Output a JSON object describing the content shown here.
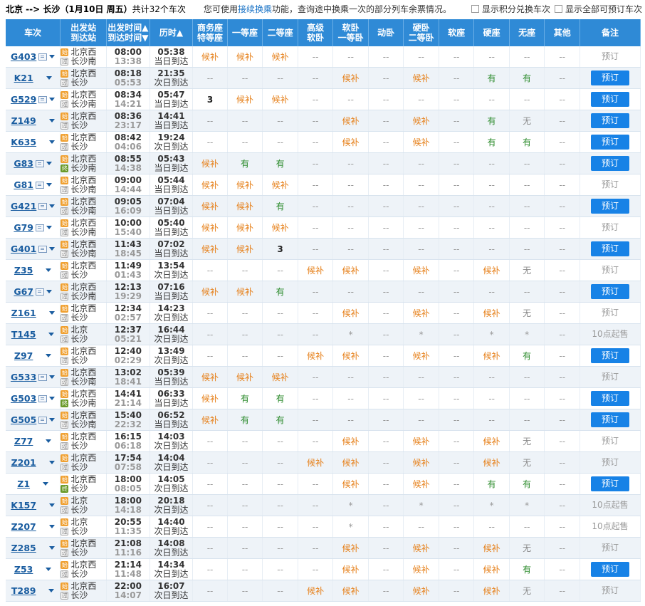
{
  "top": {
    "route": "北京 --> 长沙",
    "date": "（1月10日  周五）",
    "count_text": "共计32个车次",
    "hint_pre": "您可使用",
    "hint_link": "接续换乘",
    "hint_post": "功能，查询途中换乘一次的部分列车余票情况。",
    "opt1": "显示积分兑换车次",
    "opt2": "显示全部可预订车次"
  },
  "header": {
    "train": "车次",
    "station": [
      "出发站",
      "到达站"
    ],
    "time": [
      "出发时间▲",
      "到达时间▼"
    ],
    "duration": "历时▲",
    "seats": [
      [
        "商务座",
        "特等座"
      ],
      [
        "一等座"
      ],
      [
        "二等座"
      ],
      [
        "高级",
        "软卧"
      ],
      [
        "软卧",
        "一等卧"
      ],
      [
        "动卧"
      ],
      [
        "硬卧",
        "二等卧"
      ],
      [
        "软座"
      ],
      [
        "硬座"
      ],
      [
        "无座"
      ],
      [
        "其他"
      ]
    ],
    "remark": "备注"
  },
  "rows": [
    {
      "no": "G403",
      "icon": true,
      "from": "北京西",
      "to": "长沙南",
      "fb": "s",
      "tb": "p",
      "dep": "08:00",
      "arr": "13:38",
      "dur": "05:38",
      "note": "当日到达",
      "seats": [
        "候补",
        "候补",
        "候补",
        "--",
        "--",
        "--",
        "--",
        "--",
        "--",
        "--",
        "--"
      ],
      "btn": "预订",
      "on": false
    },
    {
      "no": "K21",
      "icon": false,
      "from": "北京西",
      "to": "长沙",
      "fb": "s",
      "tb": "p",
      "dep": "08:18",
      "arr": "05:53",
      "dur": "21:35",
      "note": "次日到达",
      "seats": [
        "--",
        "--",
        "--",
        "--",
        "候补",
        "--",
        "候补",
        "--",
        "有",
        "有",
        "--"
      ],
      "btn": "预订",
      "on": true
    },
    {
      "no": "G529",
      "icon": true,
      "from": "北京西",
      "to": "长沙南",
      "fb": "s",
      "tb": "p",
      "dep": "08:34",
      "arr": "14:21",
      "dur": "05:47",
      "note": "当日到达",
      "seats": [
        "3",
        "候补",
        "候补",
        "--",
        "--",
        "--",
        "--",
        "--",
        "--",
        "--",
        "--"
      ],
      "btn": "预订",
      "on": true
    },
    {
      "no": "Z149",
      "icon": false,
      "from": "北京西",
      "to": "长沙",
      "fb": "s",
      "tb": "p",
      "dep": "08:36",
      "arr": "23:17",
      "dur": "14:41",
      "note": "当日到达",
      "seats": [
        "--",
        "--",
        "--",
        "--",
        "候补",
        "--",
        "候补",
        "--",
        "有",
        "无",
        "--"
      ],
      "btn": "预订",
      "on": true
    },
    {
      "no": "K635",
      "icon": false,
      "from": "北京西",
      "to": "长沙",
      "fb": "s",
      "tb": "p",
      "dep": "08:42",
      "arr": "04:06",
      "dur": "19:24",
      "note": "次日到达",
      "seats": [
        "--",
        "--",
        "--",
        "--",
        "候补",
        "--",
        "候补",
        "--",
        "有",
        "有",
        "--"
      ],
      "btn": "预订",
      "on": true
    },
    {
      "no": "G83",
      "icon": true,
      "from": "北京西",
      "to": "长沙南",
      "fb": "s",
      "tb": "e",
      "dep": "08:55",
      "arr": "14:38",
      "dur": "05:43",
      "note": "当日到达",
      "seats": [
        "候补",
        "有",
        "有",
        "--",
        "--",
        "--",
        "--",
        "--",
        "--",
        "--",
        "--"
      ],
      "btn": "预订",
      "on": true
    },
    {
      "no": "G81",
      "icon": true,
      "from": "北京西",
      "to": "长沙南",
      "fb": "s",
      "tb": "p",
      "dep": "09:00",
      "arr": "14:44",
      "dur": "05:44",
      "note": "当日到达",
      "seats": [
        "候补",
        "候补",
        "候补",
        "--",
        "--",
        "--",
        "--",
        "--",
        "--",
        "--",
        "--"
      ],
      "btn": "预订",
      "on": false
    },
    {
      "no": "G421",
      "icon": true,
      "from": "北京西",
      "to": "长沙南",
      "fb": "s",
      "tb": "p",
      "dep": "09:05",
      "arr": "16:09",
      "dur": "07:04",
      "note": "当日到达",
      "seats": [
        "候补",
        "候补",
        "有",
        "--",
        "--",
        "--",
        "--",
        "--",
        "--",
        "--",
        "--"
      ],
      "btn": "预订",
      "on": true
    },
    {
      "no": "G79",
      "icon": true,
      "from": "北京西",
      "to": "长沙南",
      "fb": "s",
      "tb": "p",
      "dep": "10:00",
      "arr": "15:40",
      "dur": "05:40",
      "note": "当日到达",
      "seats": [
        "候补",
        "候补",
        "候补",
        "--",
        "--",
        "--",
        "--",
        "--",
        "--",
        "--",
        "--"
      ],
      "btn": "预订",
      "on": false
    },
    {
      "no": "G401",
      "icon": true,
      "from": "北京西",
      "to": "长沙南",
      "fb": "s",
      "tb": "p",
      "dep": "11:43",
      "arr": "18:45",
      "dur": "07:02",
      "note": "当日到达",
      "seats": [
        "候补",
        "候补",
        "3",
        "--",
        "--",
        "--",
        "--",
        "--",
        "--",
        "--",
        "--"
      ],
      "btn": "预订",
      "on": true
    },
    {
      "no": "Z35",
      "icon": false,
      "from": "北京西",
      "to": "长沙",
      "fb": "s",
      "tb": "p",
      "dep": "11:49",
      "arr": "01:43",
      "dur": "13:54",
      "note": "次日到达",
      "seats": [
        "--",
        "--",
        "--",
        "候补",
        "候补",
        "--",
        "候补",
        "--",
        "候补",
        "无",
        "--"
      ],
      "btn": "预订",
      "on": false
    },
    {
      "no": "G67",
      "icon": true,
      "from": "北京西",
      "to": "长沙南",
      "fb": "s",
      "tb": "p",
      "dep": "12:13",
      "arr": "19:29",
      "dur": "07:16",
      "note": "当日到达",
      "seats": [
        "候补",
        "候补",
        "有",
        "--",
        "--",
        "--",
        "--",
        "--",
        "--",
        "--",
        "--"
      ],
      "btn": "预订",
      "on": true
    },
    {
      "no": "Z161",
      "icon": false,
      "from": "北京西",
      "to": "长沙",
      "fb": "s",
      "tb": "p",
      "dep": "12:34",
      "arr": "02:57",
      "dur": "14:23",
      "note": "次日到达",
      "seats": [
        "--",
        "--",
        "--",
        "--",
        "候补",
        "--",
        "候补",
        "--",
        "候补",
        "无",
        "--"
      ],
      "btn": "预订",
      "on": false
    },
    {
      "no": "T145",
      "icon": false,
      "from": "北京",
      "to": "长沙",
      "fb": "s",
      "tb": "p",
      "dep": "12:37",
      "arr": "05:21",
      "dur": "16:44",
      "note": "次日到达",
      "seats": [
        "--",
        "--",
        "--",
        "--",
        "*",
        "--",
        "*",
        "--",
        "*",
        "*",
        "--"
      ],
      "btn": "10点起售",
      "on": false,
      "txt": true
    },
    {
      "no": "Z97",
      "icon": false,
      "from": "北京西",
      "to": "长沙",
      "fb": "s",
      "tb": "p",
      "dep": "12:40",
      "arr": "02:29",
      "dur": "13:49",
      "note": "次日到达",
      "seats": [
        "--",
        "--",
        "--",
        "候补",
        "候补",
        "--",
        "候补",
        "--",
        "候补",
        "有",
        "--"
      ],
      "btn": "预订",
      "on": true
    },
    {
      "no": "G533",
      "icon": true,
      "from": "北京西",
      "to": "长沙南",
      "fb": "s",
      "tb": "p",
      "dep": "13:02",
      "arr": "18:41",
      "dur": "05:39",
      "note": "当日到达",
      "seats": [
        "候补",
        "候补",
        "候补",
        "--",
        "--",
        "--",
        "--",
        "--",
        "--",
        "--",
        "--"
      ],
      "btn": "预订",
      "on": false
    },
    {
      "no": "G503",
      "icon": true,
      "from": "北京西",
      "to": "长沙南",
      "fb": "s",
      "tb": "e",
      "dep": "14:41",
      "arr": "21:14",
      "dur": "06:33",
      "note": "当日到达",
      "seats": [
        "候补",
        "有",
        "有",
        "--",
        "--",
        "--",
        "--",
        "--",
        "--",
        "--",
        "--"
      ],
      "btn": "预订",
      "on": true
    },
    {
      "no": "G505",
      "icon": true,
      "from": "北京西",
      "to": "长沙南",
      "fb": "s",
      "tb": "p",
      "dep": "15:40",
      "arr": "22:32",
      "dur": "06:52",
      "note": "当日到达",
      "seats": [
        "候补",
        "有",
        "有",
        "--",
        "--",
        "--",
        "--",
        "--",
        "--",
        "--",
        "--"
      ],
      "btn": "预订",
      "on": true
    },
    {
      "no": "Z77",
      "icon": false,
      "from": "北京西",
      "to": "长沙",
      "fb": "s",
      "tb": "p",
      "dep": "16:15",
      "arr": "06:18",
      "dur": "14:03",
      "note": "次日到达",
      "seats": [
        "--",
        "--",
        "--",
        "--",
        "候补",
        "--",
        "候补",
        "--",
        "候补",
        "无",
        "--"
      ],
      "btn": "预订",
      "on": false
    },
    {
      "no": "Z201",
      "icon": false,
      "from": "北京西",
      "to": "长沙",
      "fb": "s",
      "tb": "p",
      "dep": "17:54",
      "arr": "07:58",
      "dur": "14:04",
      "note": "次日到达",
      "seats": [
        "--",
        "--",
        "--",
        "候补",
        "候补",
        "--",
        "候补",
        "--",
        "候补",
        "无",
        "--"
      ],
      "btn": "预订",
      "on": false
    },
    {
      "no": "Z1",
      "icon": false,
      "from": "北京西",
      "to": "长沙",
      "fb": "s",
      "tb": "e",
      "dep": "18:00",
      "arr": "08:05",
      "dur": "14:05",
      "note": "次日到达",
      "seats": [
        "--",
        "--",
        "--",
        "--",
        "候补",
        "--",
        "候补",
        "--",
        "有",
        "有",
        "--"
      ],
      "btn": "预订",
      "on": true
    },
    {
      "no": "K157",
      "icon": false,
      "from": "北京",
      "to": "长沙",
      "fb": "s",
      "tb": "p",
      "dep": "18:00",
      "arr": "14:18",
      "dur": "20:18",
      "note": "次日到达",
      "seats": [
        "--",
        "--",
        "--",
        "--",
        "*",
        "--",
        "*",
        "--",
        "*",
        "*",
        "--"
      ],
      "btn": "10点起售",
      "on": false,
      "txt": true
    },
    {
      "no": "Z207",
      "icon": false,
      "from": "北京",
      "to": "长沙",
      "fb": "s",
      "tb": "p",
      "dep": "20:55",
      "arr": "11:35",
      "dur": "14:40",
      "note": "次日到达",
      "seats": [
        "--",
        "--",
        "--",
        "--",
        "*",
        "--",
        "--",
        "--",
        "--",
        "--",
        "--"
      ],
      "btn": "10点起售",
      "on": false,
      "txt": true
    },
    {
      "no": "Z285",
      "icon": false,
      "from": "北京西",
      "to": "长沙",
      "fb": "s",
      "tb": "p",
      "dep": "21:08",
      "arr": "11:16",
      "dur": "14:08",
      "note": "次日到达",
      "seats": [
        "--",
        "--",
        "--",
        "--",
        "候补",
        "--",
        "候补",
        "--",
        "候补",
        "无",
        "--"
      ],
      "btn": "预订",
      "on": false
    },
    {
      "no": "Z53",
      "icon": false,
      "from": "北京西",
      "to": "长沙",
      "fb": "s",
      "tb": "p",
      "dep": "21:14",
      "arr": "11:48",
      "dur": "14:34",
      "note": "次日到达",
      "seats": [
        "--",
        "--",
        "--",
        "--",
        "候补",
        "--",
        "候补",
        "--",
        "候补",
        "有",
        "--"
      ],
      "btn": "预订",
      "on": true
    },
    {
      "no": "T289",
      "icon": false,
      "from": "北京西",
      "to": "长沙",
      "fb": "s",
      "tb": "p",
      "dep": "22:00",
      "arr": "14:07",
      "dur": "16:07",
      "note": "次日到达",
      "seats": [
        "--",
        "--",
        "--",
        "候补",
        "候补",
        "--",
        "候补",
        "--",
        "候补",
        "无",
        "--"
      ],
      "btn": "预订",
      "on": false
    }
  ]
}
